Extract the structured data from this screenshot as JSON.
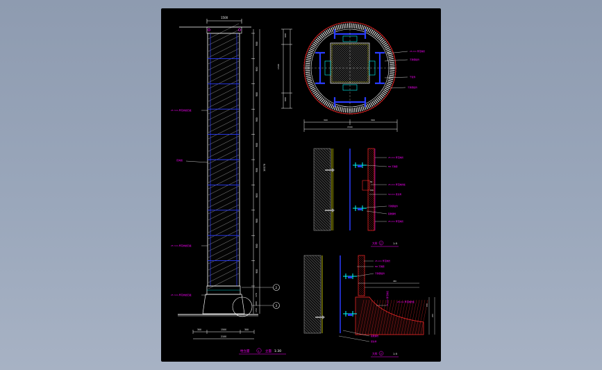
{
  "colors": {
    "background": "#8e9bb0",
    "canvas": "#000000",
    "dimension": "#ffffff",
    "annotation": "#ff00ff",
    "stone": "#ffffff",
    "steel": "#2a3cff",
    "accent": "#00ffff",
    "section": "#ff2a2a",
    "wall": "#9a9a9a",
    "stud": "#ffff00"
  },
  "column_elevation": {
    "top_width": "1500",
    "total_height": "10170",
    "segments": [
      "900",
      "900",
      "900",
      "900",
      "900",
      "900",
      "900",
      "900",
      "900",
      "900"
    ],
    "base_dims": [
      "300",
      "1500",
      "300"
    ],
    "base_total": "2100",
    "left_labels": [
      "25 mm 厚花岗岩石板",
      "花岗岩",
      "25 mm 厚花岗岩石板",
      "25 mm 厚花岗岩石板"
    ],
    "right_bottom_dims": [
      "170",
      "200",
      "150"
    ],
    "title": "柱立面",
    "title_number": "1",
    "scale_label": "立面",
    "scale": "1:30",
    "detail_markers": [
      "2",
      "3"
    ]
  },
  "plan_section": {
    "vertical_dims": [
      "600",
      "1500",
      "600"
    ],
    "horizontal_dims": [
      "300",
      "1500",
      "300"
    ],
    "labels": [
      "25 mm 厚花岗岩",
      "不锈钢挂件",
      "干挂件",
      "不锈钢挂件"
    ]
  },
  "detail_2": {
    "labels": [
      "25 mm 厚花岗岩",
      "M6 不锈钢",
      "25 mm 厚花岗岩板",
      "50 mm 竖龙骨",
      "不锈钢挂件",
      "膨胀螺栓",
      "25 mm 厚花岗岩"
    ],
    "dims": [
      "50",
      "150"
    ],
    "title": "大样",
    "number": "2",
    "scale": "1:5"
  },
  "detail_3": {
    "labels": [
      "25 mm 厚花岗岩",
      "M6 不锈钢",
      "不锈钢挂件",
      "25 mm 厚花岗岩",
      "25 mm 厚花岗岩板",
      "膨胀螺栓",
      "竖龙骨"
    ],
    "dims": [
      "450",
      "150",
      "200"
    ],
    "title": "大样",
    "number": "3",
    "scale": "1:5"
  }
}
